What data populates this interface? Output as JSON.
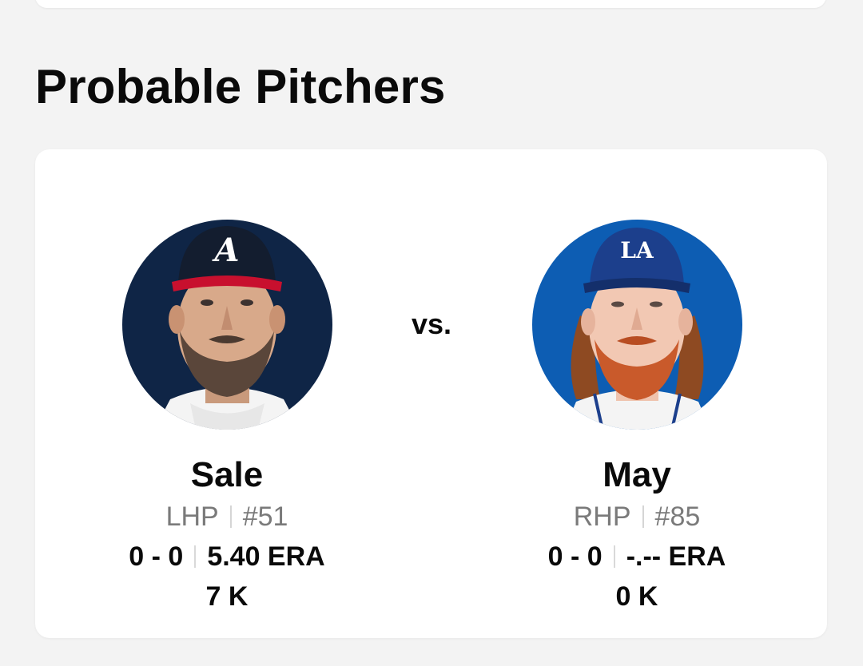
{
  "section": {
    "title": "Probable Pitchers"
  },
  "matchup": {
    "vs_label": "vs.",
    "away": {
      "last_name": "Sale",
      "position": "LHP",
      "number": "#51",
      "record": "0 - 0",
      "era": "5.40 ERA",
      "strikeouts": "7 K",
      "headshot_bg": "#0f2546",
      "cap_color": "#131d2f",
      "cap_brim_color": "#c8102e",
      "cap_logo": "A"
    },
    "home": {
      "last_name": "May",
      "position": "RHP",
      "number": "#85",
      "record": "0 - 0",
      "era": "-.-- ERA",
      "strikeouts": "0 K",
      "headshot_bg": "#0d5db3",
      "cap_color": "#1c3f8c",
      "cap_logo": "LA"
    }
  }
}
